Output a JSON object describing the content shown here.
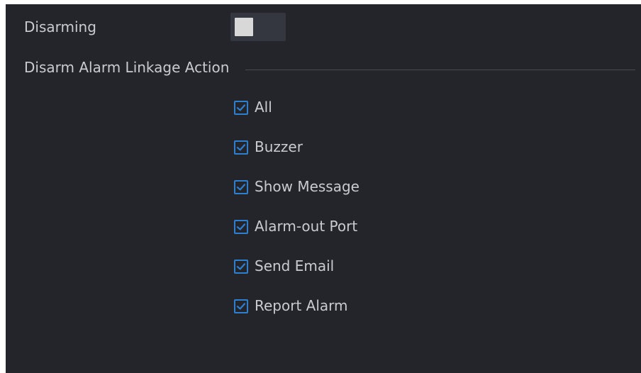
{
  "disarming": {
    "label": "Disarming",
    "enabled": false
  },
  "section": {
    "title": "Disarm Alarm Linkage Action"
  },
  "options": [
    {
      "label": "All",
      "checked": true
    },
    {
      "label": "Buzzer",
      "checked": true
    },
    {
      "label": "Show Message",
      "checked": true
    },
    {
      "label": "Alarm-out Port",
      "checked": true
    },
    {
      "label": "Send Email",
      "checked": true
    },
    {
      "label": "Report Alarm",
      "checked": true
    }
  ],
  "colors": {
    "background": "#24252b",
    "text": "#c9cbd0",
    "checkbox_accent": "#2f7fd1",
    "toggle_track": "#34373f",
    "toggle_knob": "#d8d8d8"
  },
  "icons": {
    "check": "check-icon"
  }
}
